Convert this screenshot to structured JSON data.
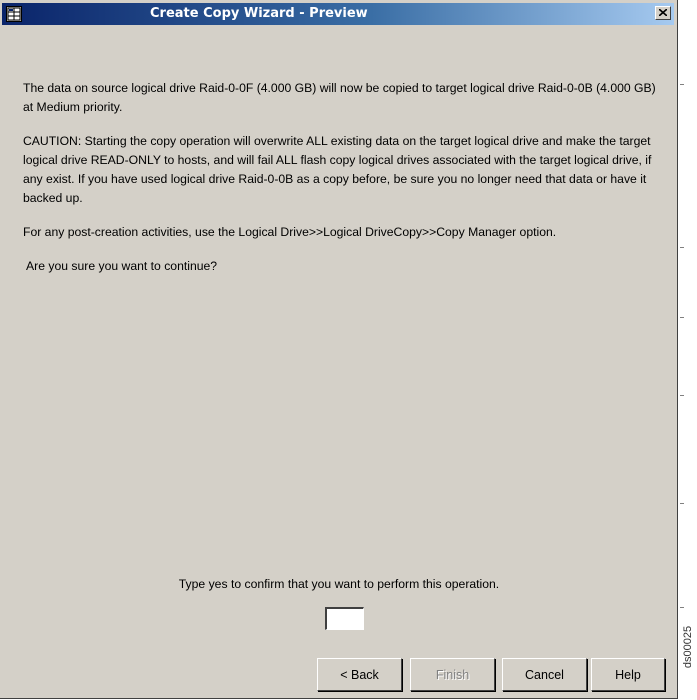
{
  "window": {
    "title": "Create Copy Wizard - Preview"
  },
  "message": {
    "summary": "The data on source logical drive Raid-0-0F (4.000 GB) will now be copied to target logical drive Raid-0-0B (4.000 GB) at Medium priority.",
    "caution": "CAUTION: Starting the copy operation will overwrite ALL existing data on the target logical drive and make the target logical drive READ-ONLY to hosts, and will fail ALL flash copy logical drives associated with the target logical drive, if any exist. If you have used logical drive Raid-0-0B as a copy before, be sure you no longer need that data or have it backed up.",
    "post_creation": "For any post-creation activities, use the Logical Drive>>Logical DriveCopy>>Copy Manager option.",
    "question": "Are you sure you want to continue?"
  },
  "confirm": {
    "label": "Type yes to confirm that you want to perform this operation.",
    "value": ""
  },
  "buttons": {
    "back": "< Back",
    "finish": "Finish",
    "cancel": "Cancel",
    "help": "Help"
  },
  "side_code": "ds00025"
}
